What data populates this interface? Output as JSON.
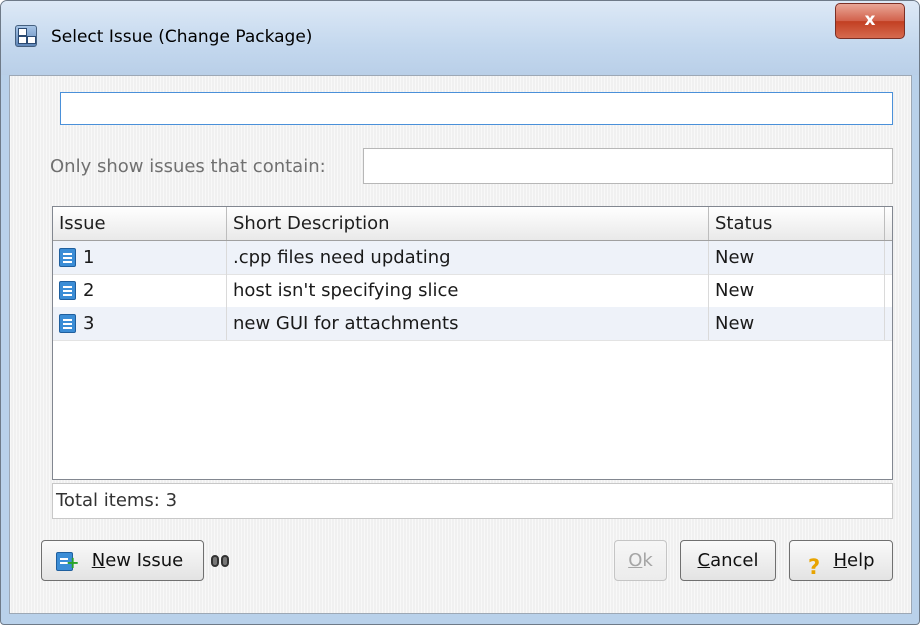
{
  "window": {
    "title": "Select Issue (Change Package)",
    "close_glyph": "x"
  },
  "search": {
    "value": ""
  },
  "filter": {
    "label": "Only show issues that contain:",
    "value": ""
  },
  "table": {
    "columns": [
      "Issue",
      "Short Description",
      "Status"
    ],
    "rows": [
      {
        "issue": "1",
        "description": ".cpp files need updating",
        "status": "New"
      },
      {
        "issue": "2",
        "description": "host isn't specifying slice",
        "status": "New"
      },
      {
        "issue": "3",
        "description": "new GUI for attachments",
        "status": "New"
      }
    ]
  },
  "footer": {
    "total": "Total items: 3"
  },
  "buttons": {
    "new_issue": {
      "mnemonic": "N",
      "rest": "ew Issue"
    },
    "ok": {
      "mnemonic": "O",
      "rest": "k"
    },
    "cancel": {
      "mnemonic": "C",
      "rest": "ancel"
    },
    "help": {
      "mnemonic": "H",
      "rest": "elp"
    }
  },
  "icons": {
    "app": "window-app-icon",
    "issue_row": "issue-document-icon",
    "new_issue": "new-issue-icon",
    "find": "binoculars-icon",
    "help": "question-mark-icon"
  },
  "colors": {
    "accent": "#4a90d9",
    "close_button": "#c23f22",
    "title_bar": "#c4d8ee"
  }
}
